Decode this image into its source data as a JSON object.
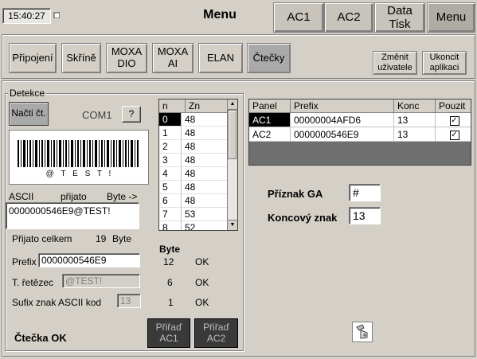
{
  "header": {
    "clock": "15:40:27",
    "title": "Menu",
    "buttons": [
      "AC1",
      "AC2",
      "Data\nTisk",
      "Menu"
    ]
  },
  "nav": {
    "tabs": [
      "Připojení",
      "Skříně",
      "MOXA\nDIO",
      "MOXA\nAI",
      "ELAN",
      "Čtečky"
    ],
    "active_index": 5,
    "change_user": "Změnit\nuživatele",
    "exit_app": "Ukoncit\naplikaci"
  },
  "detekce": {
    "legend": "Detekce",
    "read_button": "Načti čt.",
    "port": "COM1",
    "help_button": "?",
    "barcode_text": "@ T E S T !",
    "ascii_label": "ASCII",
    "received_label": "přijato",
    "byte_arrow_label": "Byte ->",
    "ascii_value": "0000000546E9@TEST!",
    "total_label": "Přijato celkem",
    "total_value": "19",
    "total_unit": "Byte",
    "byte_header": "Byte",
    "prefix_label": "Prefix",
    "prefix_value": "0000000546E9",
    "prefix_bytes": "12",
    "prefix_status": "OK",
    "string_label": "T. řetězec",
    "string_value": "@TEST!",
    "string_bytes": "6",
    "string_status": "OK",
    "suffix_label": "Sufix znak ASCII kod",
    "suffix_value": "13",
    "suffix_bytes": "1",
    "suffix_status": "OK",
    "status_text": "Čtečka OK",
    "assign_ac1": "Přiřaď\nAC1",
    "assign_ac2": "Přiřaď\nAC2"
  },
  "byte_list": {
    "headers": [
      "n",
      "Zn"
    ],
    "selected_index": 0,
    "rows": [
      [
        "0",
        "48"
      ],
      [
        "1",
        "48"
      ],
      [
        "2",
        "48"
      ],
      [
        "3",
        "48"
      ],
      [
        "4",
        "48"
      ],
      [
        "5",
        "48"
      ],
      [
        "6",
        "48"
      ],
      [
        "7",
        "53"
      ],
      [
        "8",
        "52"
      ]
    ]
  },
  "panel_table": {
    "headers": [
      "Panel",
      "Prefix",
      "Konc",
      "Pouzit"
    ],
    "selected_row": 0,
    "rows": [
      {
        "panel": "AC1",
        "prefix": "00000004AFD6",
        "konc": "13",
        "pouzit": true
      },
      {
        "panel": "AC2",
        "prefix": "0000000546E9",
        "konc": "13",
        "pouzit": true
      }
    ]
  },
  "settings": {
    "ga_flag_label": "Příznak GA",
    "ga_flag_value": "#",
    "end_char_label": "Koncový znak",
    "end_char_value": "13"
  },
  "icons": {
    "clock_indicator": "status-square-icon",
    "bottom_right": "scanner-icon"
  }
}
